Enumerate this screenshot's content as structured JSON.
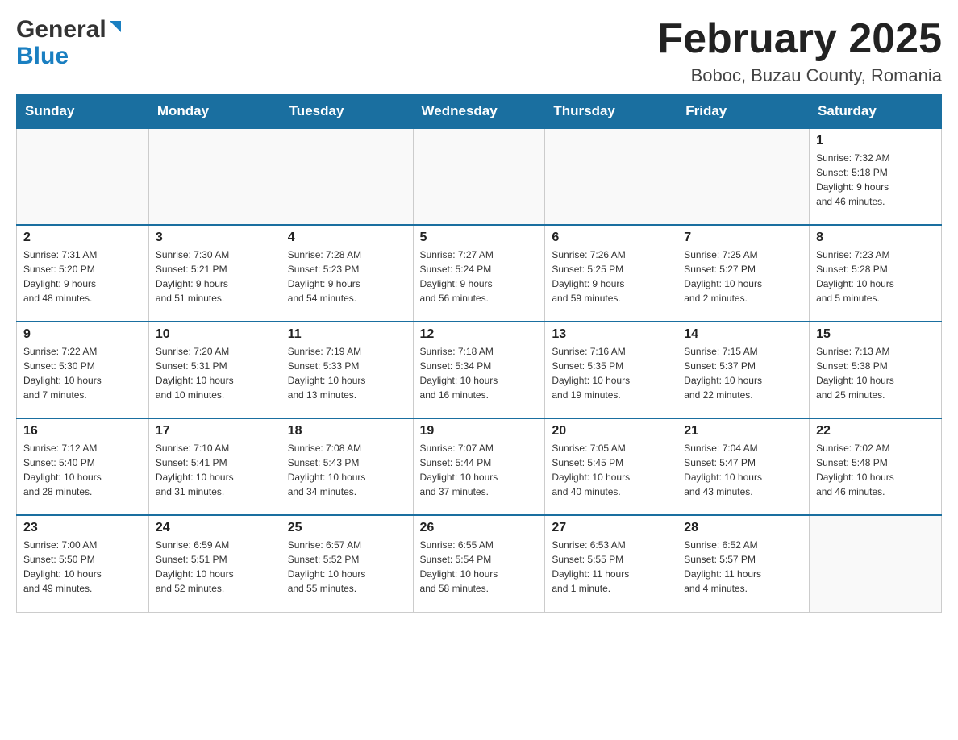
{
  "header": {
    "logo_general": "General",
    "logo_blue": "Blue",
    "title": "February 2025",
    "subtitle": "Boboc, Buzau County, Romania"
  },
  "days_of_week": [
    "Sunday",
    "Monday",
    "Tuesday",
    "Wednesday",
    "Thursday",
    "Friday",
    "Saturday"
  ],
  "weeks": [
    {
      "days": [
        {
          "number": "",
          "info": ""
        },
        {
          "number": "",
          "info": ""
        },
        {
          "number": "",
          "info": ""
        },
        {
          "number": "",
          "info": ""
        },
        {
          "number": "",
          "info": ""
        },
        {
          "number": "",
          "info": ""
        },
        {
          "number": "1",
          "info": "Sunrise: 7:32 AM\nSunset: 5:18 PM\nDaylight: 9 hours\nand 46 minutes."
        }
      ]
    },
    {
      "days": [
        {
          "number": "2",
          "info": "Sunrise: 7:31 AM\nSunset: 5:20 PM\nDaylight: 9 hours\nand 48 minutes."
        },
        {
          "number": "3",
          "info": "Sunrise: 7:30 AM\nSunset: 5:21 PM\nDaylight: 9 hours\nand 51 minutes."
        },
        {
          "number": "4",
          "info": "Sunrise: 7:28 AM\nSunset: 5:23 PM\nDaylight: 9 hours\nand 54 minutes."
        },
        {
          "number": "5",
          "info": "Sunrise: 7:27 AM\nSunset: 5:24 PM\nDaylight: 9 hours\nand 56 minutes."
        },
        {
          "number": "6",
          "info": "Sunrise: 7:26 AM\nSunset: 5:25 PM\nDaylight: 9 hours\nand 59 minutes."
        },
        {
          "number": "7",
          "info": "Sunrise: 7:25 AM\nSunset: 5:27 PM\nDaylight: 10 hours\nand 2 minutes."
        },
        {
          "number": "8",
          "info": "Sunrise: 7:23 AM\nSunset: 5:28 PM\nDaylight: 10 hours\nand 5 minutes."
        }
      ]
    },
    {
      "days": [
        {
          "number": "9",
          "info": "Sunrise: 7:22 AM\nSunset: 5:30 PM\nDaylight: 10 hours\nand 7 minutes."
        },
        {
          "number": "10",
          "info": "Sunrise: 7:20 AM\nSunset: 5:31 PM\nDaylight: 10 hours\nand 10 minutes."
        },
        {
          "number": "11",
          "info": "Sunrise: 7:19 AM\nSunset: 5:33 PM\nDaylight: 10 hours\nand 13 minutes."
        },
        {
          "number": "12",
          "info": "Sunrise: 7:18 AM\nSunset: 5:34 PM\nDaylight: 10 hours\nand 16 minutes."
        },
        {
          "number": "13",
          "info": "Sunrise: 7:16 AM\nSunset: 5:35 PM\nDaylight: 10 hours\nand 19 minutes."
        },
        {
          "number": "14",
          "info": "Sunrise: 7:15 AM\nSunset: 5:37 PM\nDaylight: 10 hours\nand 22 minutes."
        },
        {
          "number": "15",
          "info": "Sunrise: 7:13 AM\nSunset: 5:38 PM\nDaylight: 10 hours\nand 25 minutes."
        }
      ]
    },
    {
      "days": [
        {
          "number": "16",
          "info": "Sunrise: 7:12 AM\nSunset: 5:40 PM\nDaylight: 10 hours\nand 28 minutes."
        },
        {
          "number": "17",
          "info": "Sunrise: 7:10 AM\nSunset: 5:41 PM\nDaylight: 10 hours\nand 31 minutes."
        },
        {
          "number": "18",
          "info": "Sunrise: 7:08 AM\nSunset: 5:43 PM\nDaylight: 10 hours\nand 34 minutes."
        },
        {
          "number": "19",
          "info": "Sunrise: 7:07 AM\nSunset: 5:44 PM\nDaylight: 10 hours\nand 37 minutes."
        },
        {
          "number": "20",
          "info": "Sunrise: 7:05 AM\nSunset: 5:45 PM\nDaylight: 10 hours\nand 40 minutes."
        },
        {
          "number": "21",
          "info": "Sunrise: 7:04 AM\nSunset: 5:47 PM\nDaylight: 10 hours\nand 43 minutes."
        },
        {
          "number": "22",
          "info": "Sunrise: 7:02 AM\nSunset: 5:48 PM\nDaylight: 10 hours\nand 46 minutes."
        }
      ]
    },
    {
      "days": [
        {
          "number": "23",
          "info": "Sunrise: 7:00 AM\nSunset: 5:50 PM\nDaylight: 10 hours\nand 49 minutes."
        },
        {
          "number": "24",
          "info": "Sunrise: 6:59 AM\nSunset: 5:51 PM\nDaylight: 10 hours\nand 52 minutes."
        },
        {
          "number": "25",
          "info": "Sunrise: 6:57 AM\nSunset: 5:52 PM\nDaylight: 10 hours\nand 55 minutes."
        },
        {
          "number": "26",
          "info": "Sunrise: 6:55 AM\nSunset: 5:54 PM\nDaylight: 10 hours\nand 58 minutes."
        },
        {
          "number": "27",
          "info": "Sunrise: 6:53 AM\nSunset: 5:55 PM\nDaylight: 11 hours\nand 1 minute."
        },
        {
          "number": "28",
          "info": "Sunrise: 6:52 AM\nSunset: 5:57 PM\nDaylight: 11 hours\nand 4 minutes."
        },
        {
          "number": "",
          "info": ""
        }
      ]
    }
  ]
}
